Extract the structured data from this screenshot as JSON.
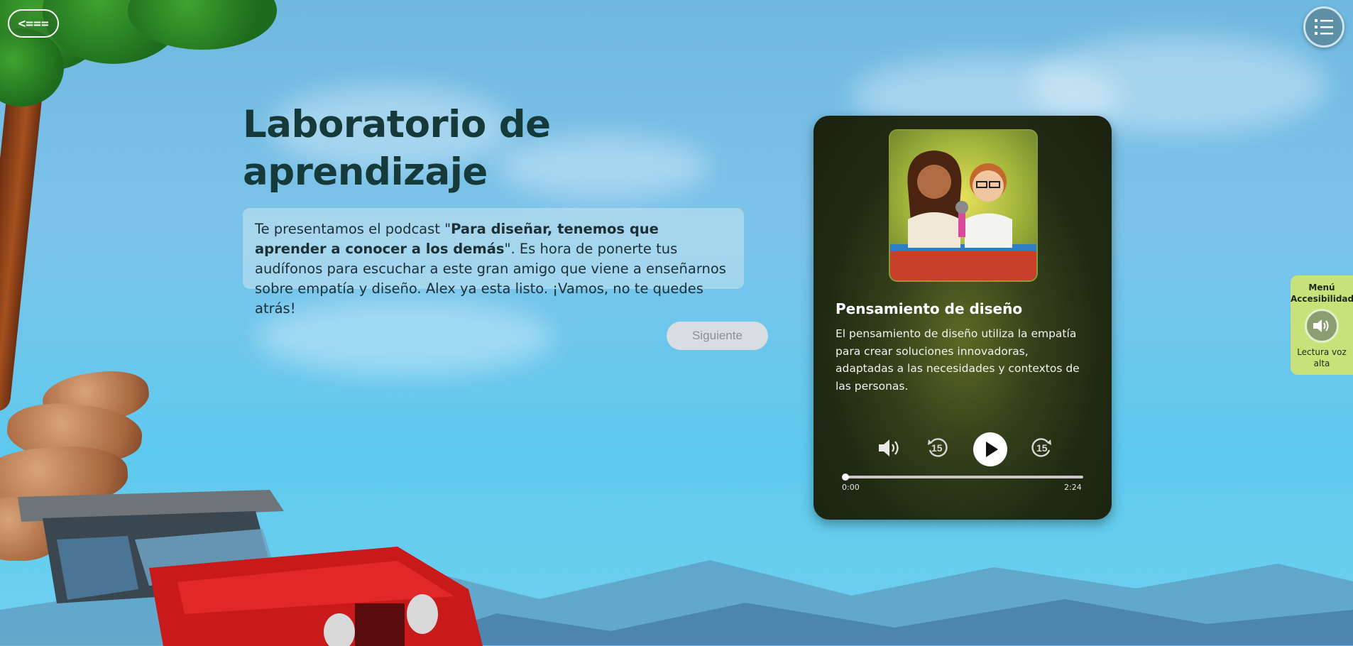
{
  "nav": {
    "back_label": "<===",
    "menu_icon": "menu-list-icon"
  },
  "main": {
    "title": "Laboratorio de aprendizaje",
    "intro": {
      "prefix": "Te presentamos el podcast \"",
      "bold": "Para diseñar, tenemos que aprender a conocer a los demás",
      "suffix": "\". Es hora de ponerte tus audífonos para escuchar a este gran amigo que viene a enseñarnos sobre empatía y diseño. Alex ya esta listo. ¡Vamos, no te quedes atrás!"
    },
    "next_label": "Siguiente"
  },
  "player": {
    "title": "Pensamiento de diseño",
    "description": "El pensamiento de diseño utiliza la empatía para crear soluciones innovadoras, adaptadas a las necesidades y contextos de las personas.",
    "rewind_label": "15",
    "forward_label": "15",
    "current_time": "0:00",
    "duration": "2:24",
    "progress": 0,
    "icons": [
      "volume-icon",
      "rewind-15-icon",
      "play-icon",
      "forward-15-icon"
    ]
  },
  "accessibility": {
    "header": "Menú Accesibilidad",
    "voice_label": "Lectura voz alta"
  }
}
